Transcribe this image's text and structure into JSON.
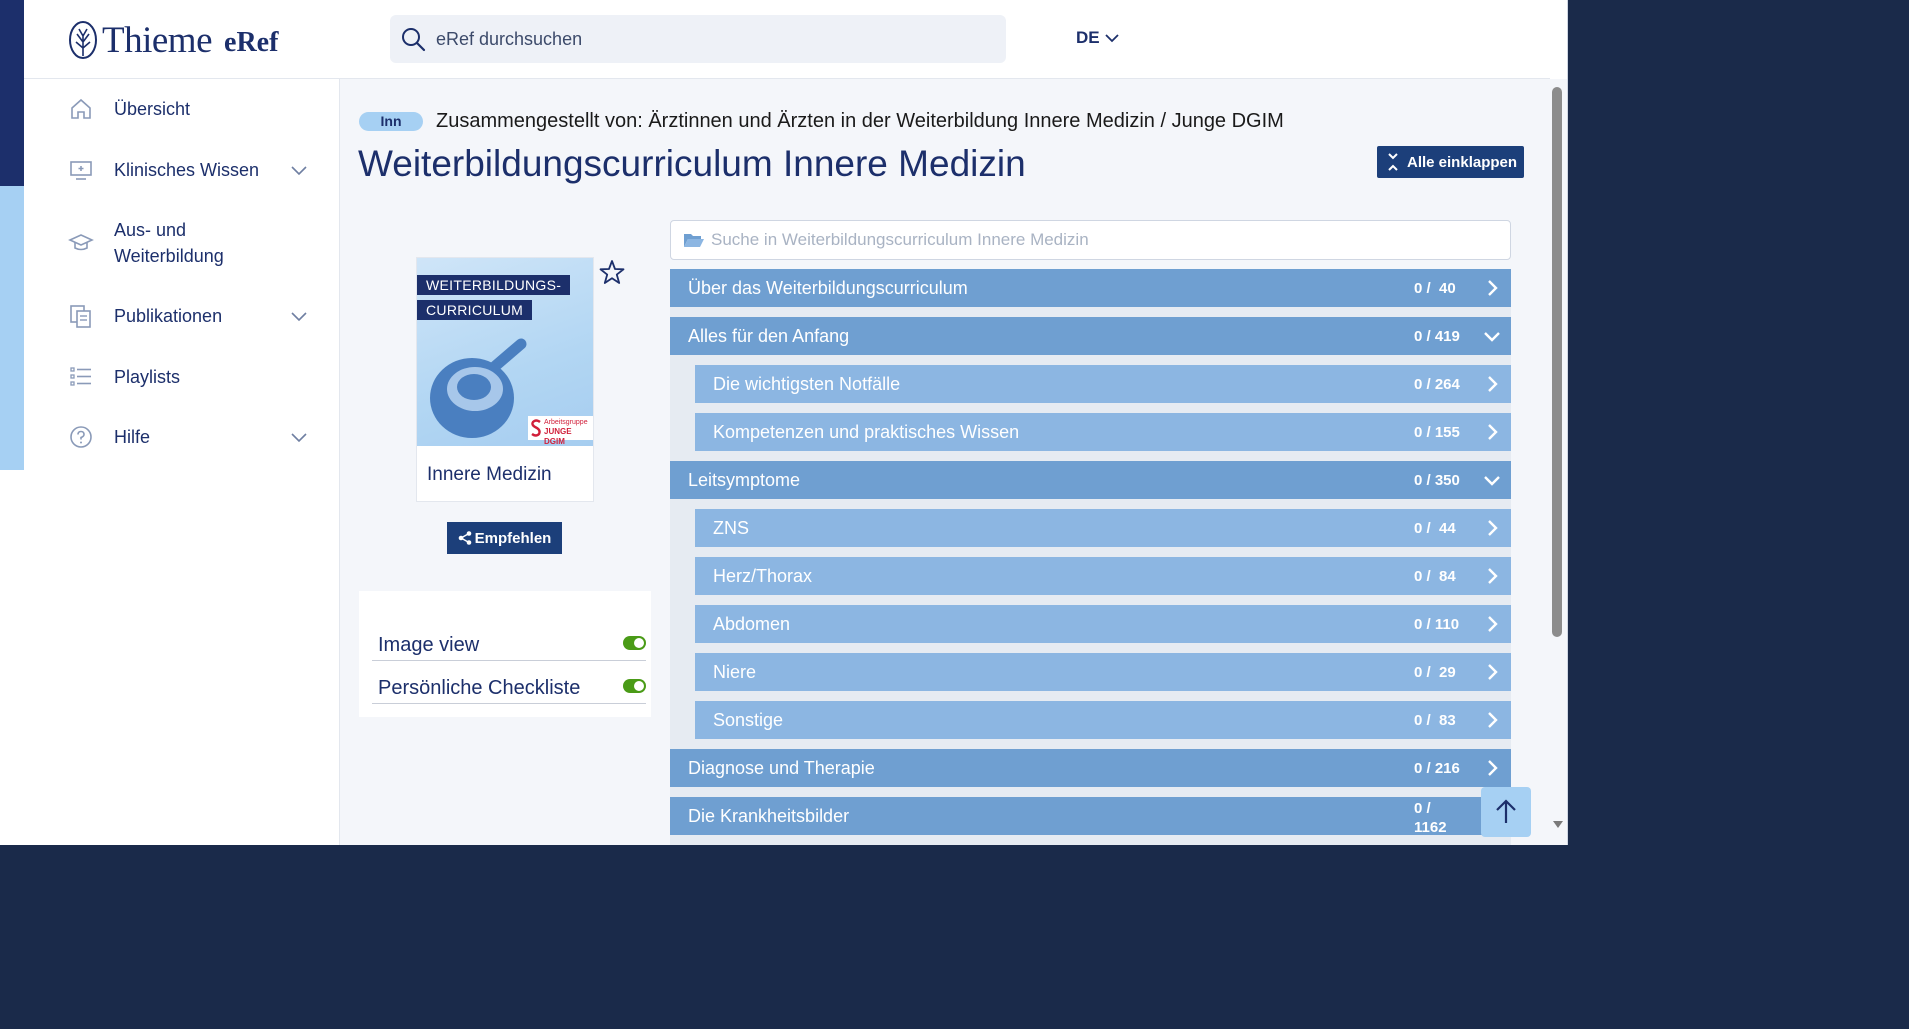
{
  "header": {
    "brand": "Thieme",
    "product": "eRef",
    "search_placeholder": "eRef durchsuchen",
    "language": "DE"
  },
  "sidebar": {
    "items": [
      {
        "label": "Übersicht",
        "icon": "home-icon"
      },
      {
        "label": "Klinisches Wissen",
        "icon": "monitor-icon",
        "expandable": true
      },
      {
        "label": "Aus- und Weiterbildung",
        "icon": "graduation-cap-icon"
      },
      {
        "label": "Publikationen",
        "icon": "documents-icon",
        "expandable": true
      },
      {
        "label": "Playlists",
        "icon": "list-icon"
      },
      {
        "label": "Hilfe",
        "icon": "help-icon",
        "expandable": true
      }
    ]
  },
  "main": {
    "badge": "Inn",
    "compiled_by": "Zusammengestellt von: Ärztinnen und Ärzten in der Weiterbildung Innere Medizin / Junge DGIM",
    "title": "Weiterbildungscurriculum Innere Medizin",
    "collapse_all": "Alle einklappen",
    "cover": {
      "tag_line1": "WEITERBILDUNGS-",
      "tag_line2": "CURRICULUM",
      "publisher_small": "Arbeitsgruppe",
      "publisher_big": "JUNGE DGIM",
      "name": "Innere Medizin"
    },
    "recommend": "Empfehlen",
    "settings": [
      {
        "label": "Image view",
        "on": true
      },
      {
        "label": "Persönliche Checkliste",
        "on": true
      }
    ],
    "curriculum_search_placeholder": "Suche in  Weiterbildungscurriculum Innere Medizin",
    "tree": [
      {
        "label": "Über das Weiterbildungscurriculum",
        "count": "0 /  40",
        "level": 1,
        "expanded": false
      },
      {
        "label": "Alles für den Anfang",
        "count": "0 / 419",
        "level": 1,
        "expanded": true
      },
      {
        "label": "Die wichtigsten Notfälle",
        "count": "0 / 264",
        "level": 2,
        "expanded": false
      },
      {
        "label": "Kompetenzen und praktisches Wissen",
        "count": "0 / 155",
        "level": 2,
        "expanded": false
      },
      {
        "label": "Leitsymptome",
        "count": "0 / 350",
        "level": 1,
        "expanded": true
      },
      {
        "label": "ZNS",
        "count": "0 /  44",
        "level": 2,
        "expanded": false
      },
      {
        "label": "Herz/Thorax",
        "count": "0 /  84",
        "level": 2,
        "expanded": false
      },
      {
        "label": "Abdomen",
        "count": "0 / 110",
        "level": 2,
        "expanded": false
      },
      {
        "label": "Niere",
        "count": "0 /  29",
        "level": 2,
        "expanded": false
      },
      {
        "label": "Sonstige",
        "count": "0 /  83",
        "level": 2,
        "expanded": false
      },
      {
        "label": "Diagnose und Therapie",
        "count": "0 / 216",
        "level": 1,
        "expanded": false
      },
      {
        "label": "Die Krankheitsbilder",
        "count": "0 /\n1162",
        "level": 1,
        "expanded": false
      }
    ]
  },
  "colors": {
    "navy": "#1c2f6b",
    "button": "#1c3f7a",
    "row_level1": "#6f9fd1",
    "row_level2": "#8cb6e2",
    "accent_light": "#a6d0f3",
    "toggle_on": "#4a9b17"
  }
}
